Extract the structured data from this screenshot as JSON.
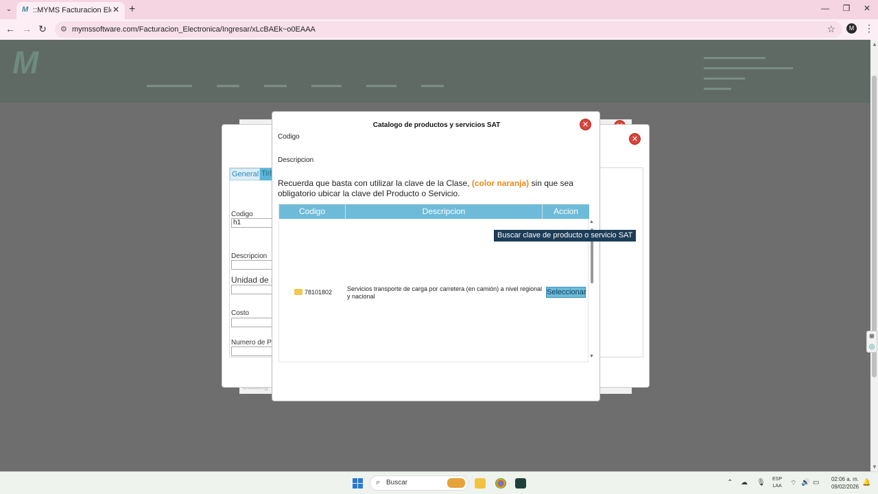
{
  "browser": {
    "tab_title": "::MYMS Facturacion Electronica",
    "url": "mymssoftware.com/Facturacion_Electronica/Ingresar/xLcBAEk~o0EAAA",
    "avatar_letter": "M"
  },
  "bg_dialog": {
    "tab_general": "General",
    "tab_tributos": "Tirb",
    "codigo_label": "Codigo",
    "codigo_value": "h1",
    "descripcion_label": "Descripcion",
    "unidad_label": "Unidad de m",
    "costo_label": "Costo",
    "costo_value": "$",
    "numero_label": "Numero de Pe"
  },
  "modal": {
    "title": "Catalogo de productos y servicios SAT",
    "codigo_label": "Codigo",
    "descripcion_label": "Descripcion",
    "note_part1": "Recuerda que basta con utilizar la clave de la Clase, ",
    "note_highlight": "(color naranja)",
    "note_part2": " sin que sea obligatorio ubicar la clave del Producto o Servicio.",
    "columns": [
      "Codigo",
      "Descripcion",
      "Accion"
    ],
    "row": {
      "code": "78101802",
      "description": "Servicios transporte de carga por carretera (en camión) a nivel regional y nacional",
      "action": "Seleccionar"
    },
    "tooltip": "Buscar clave de producto o servicio SAT"
  },
  "taskbar": {
    "search_label": "Buscar",
    "lang_line1": "ESP",
    "lang_line2": "LAA",
    "time": "02:06 a. m.",
    "date": "09/02/2026"
  },
  "colors": {
    "accent": "#6dbbd9",
    "note_highlight": "#e88a1a",
    "close": "#d9453c"
  }
}
